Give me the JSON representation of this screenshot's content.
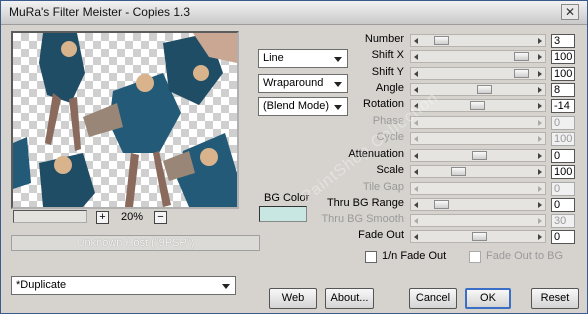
{
  "window": {
    "title": "MuRa's Filter Meister - Copies 1.3",
    "close_glyph": "✕"
  },
  "preview": {
    "zoom": "20%",
    "zoom_in": "+",
    "zoom_out": "−"
  },
  "host": "Unknown Host (\"9PSP\")",
  "dropdowns": {
    "mode": "Line",
    "edge": "Wraparound",
    "blend": "(Blend Mode)",
    "preset": "*Duplicate"
  },
  "bg_color": {
    "label": "BG Color",
    "value": "#c8e6e2"
  },
  "params": [
    {
      "label": "Number",
      "value": "3",
      "level": 0.13,
      "enabled": true
    },
    {
      "label": "Shift X",
      "value": "100",
      "level": 0.92,
      "enabled": true
    },
    {
      "label": "Shift Y",
      "value": "100",
      "level": 0.92,
      "enabled": true
    },
    {
      "label": "Angle",
      "value": "8",
      "level": 0.55,
      "enabled": true
    },
    {
      "label": "Rotation",
      "value": "-14",
      "level": 0.49,
      "enabled": true
    },
    {
      "label": "Phase",
      "value": "0",
      "level": 0.0,
      "enabled": false
    },
    {
      "label": "Cycle",
      "value": "100",
      "level": 0.0,
      "enabled": false
    },
    {
      "label": "Attenuation",
      "value": "0",
      "level": 0.5,
      "enabled": true
    },
    {
      "label": "Scale",
      "value": "100",
      "level": 0.3,
      "enabled": true
    },
    {
      "label": "Tile Gap",
      "value": "0",
      "level": 0.0,
      "enabled": false
    },
    {
      "label": "Thru BG Range",
      "value": "0",
      "level": 0.13,
      "enabled": true
    },
    {
      "label": "Thru BG Smooth",
      "value": "30",
      "level": 0.0,
      "enabled": false
    },
    {
      "label": "Fade Out",
      "value": "0",
      "level": 0.5,
      "enabled": true
    }
  ],
  "checkboxes": {
    "fade_1n": "1/n Fade Out",
    "fade_bg": "Fade Out to BG"
  },
  "buttons": {
    "web": "Web",
    "about": "About...",
    "cancel": "Cancel",
    "ok": "OK",
    "reset": "Reset"
  },
  "watermark": "PaintShop Collection"
}
